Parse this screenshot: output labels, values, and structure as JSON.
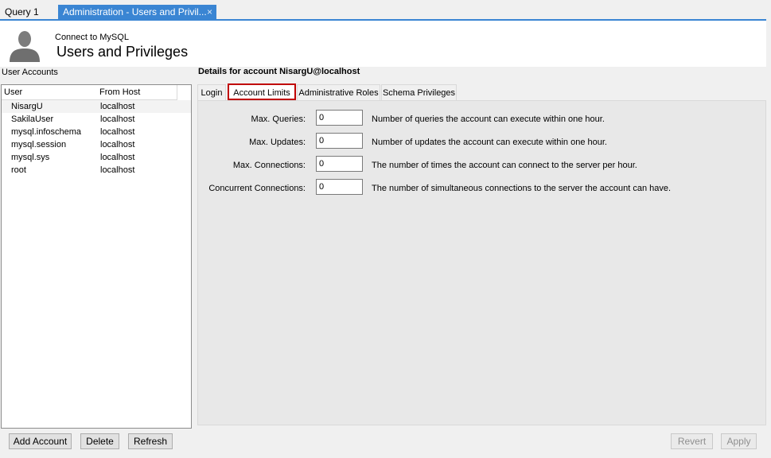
{
  "tabs": {
    "query": "Query 1",
    "admin": "Administration - Users and Privil...",
    "close_glyph": "×"
  },
  "header": {
    "connect": "Connect to MySQL",
    "title": "Users and Privileges"
  },
  "left": {
    "label": "User Accounts",
    "columns": [
      "User",
      "From Host"
    ],
    "rows": [
      {
        "user": "NisargU",
        "host": "localhost"
      },
      {
        "user": "SakilaUser",
        "host": "localhost"
      },
      {
        "user": "mysql.infoschema",
        "host": "localhost"
      },
      {
        "user": "mysql.session",
        "host": "localhost"
      },
      {
        "user": "mysql.sys",
        "host": "localhost"
      },
      {
        "user": "root",
        "host": "localhost"
      }
    ],
    "buttons": {
      "add": "Add Account",
      "delete": "Delete",
      "refresh": "Refresh"
    }
  },
  "details": {
    "label": "Details for account NisargU@localhost",
    "tabs": [
      "Login",
      "Account Limits",
      "Administrative Roles",
      "Schema Privileges"
    ],
    "fields": [
      {
        "label": "Max. Queries:",
        "value": "0",
        "desc": "Number of queries the account can execute within one hour."
      },
      {
        "label": "Max. Updates:",
        "value": "0",
        "desc": "Number of updates the account can execute within one hour."
      },
      {
        "label": "Max. Connections:",
        "value": "0",
        "desc": "The number of times the account can connect to the server per hour."
      },
      {
        "label": "Concurrent Connections:",
        "value": "0",
        "desc": "The number of simultaneous connections to the server the account can have."
      }
    ],
    "buttons": {
      "revert": "Revert",
      "apply": "Apply"
    }
  },
  "colors": {
    "accent": "#3a85d3",
    "highlight": "#c00000"
  }
}
